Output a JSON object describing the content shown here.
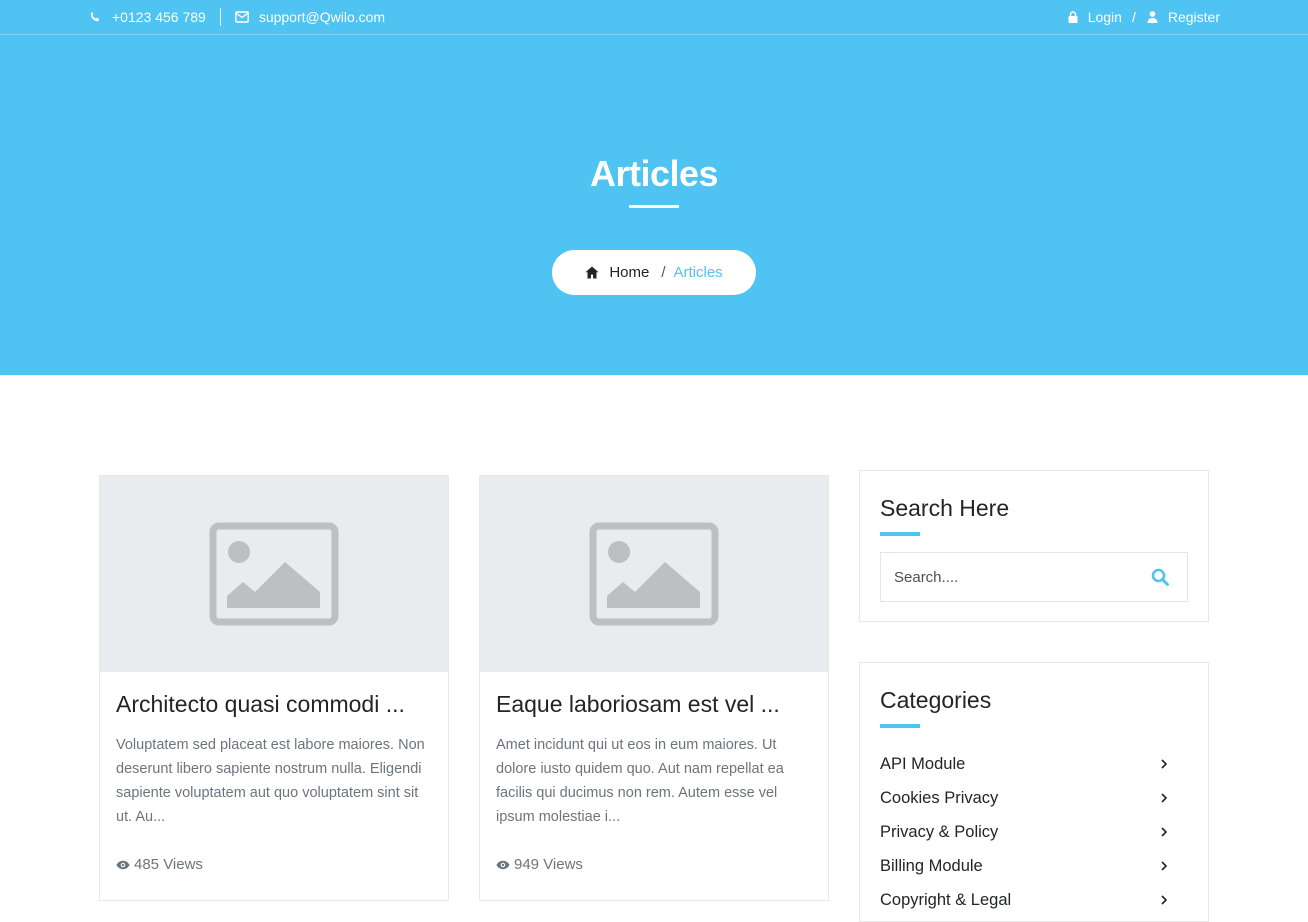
{
  "topbar": {
    "phone": "+0123 456 789",
    "email": "support@Qwilo.com",
    "login": "Login",
    "separator": "/",
    "register": "Register"
  },
  "hero": {
    "title": "Articles",
    "breadcrumb": {
      "home": "Home",
      "separator": "/",
      "current": "Articles"
    }
  },
  "articles": [
    {
      "title": "Architecto quasi commodi ...",
      "excerpt": "Voluptatem sed placeat est labore maiores. Non deserunt libero sapiente nostrum nulla. Eligendi sapiente voluptatem aut quo voluptatem sint sit ut. Au...",
      "views": "485 Views"
    },
    {
      "title": "Eaque laboriosam est vel ...",
      "excerpt": "Amet incidunt qui ut eos in eum maiores. Ut dolore iusto quidem quo. Aut nam repellat ea facilis qui ducimus non rem. Autem esse vel ipsum molestiae i...",
      "views": "949 Views"
    }
  ],
  "sidebar": {
    "search": {
      "title": "Search Here",
      "placeholder": "Search...."
    },
    "categories": {
      "title": "Categories",
      "items": [
        "API Module",
        "Cookies Privacy",
        "Privacy & Policy",
        "Billing Module",
        "Copyright & Legal"
      ]
    }
  },
  "colors": {
    "accent": "#4fc3f2",
    "placeholder_bg": "#e8ecef",
    "placeholder_icon": "#bcc0c3"
  }
}
